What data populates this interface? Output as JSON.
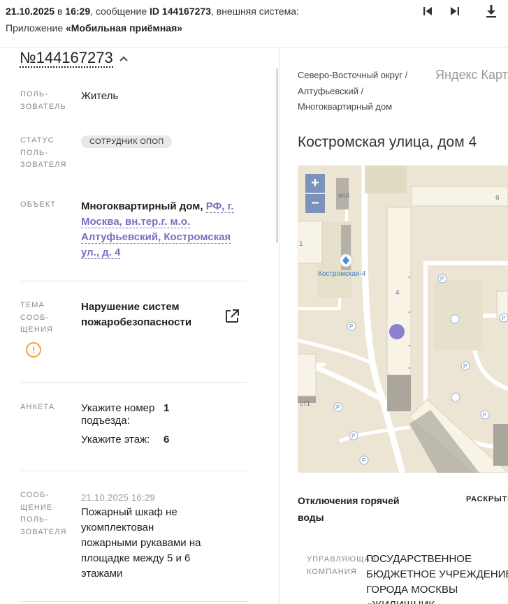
{
  "header": {
    "date": "21.10.2025",
    "in": "в",
    "time": "16:29",
    "message_text": ", сообщение",
    "message_id": "ID 144167273",
    "external_text": ", внешняя система:",
    "app_text": "Приложение",
    "app_name": "«Мобильная приёмная»",
    "icons": [
      "skip-first-icon",
      "skip-next-icon",
      "download-icon"
    ]
  },
  "ticket": {
    "number": "№144167273",
    "icon": "chevron-up-icon"
  },
  "fields": {
    "user": {
      "label": "ПОЛЬ-\nЗОВАТЕЛЬ",
      "value": "Житель"
    },
    "user_status": {
      "label": "СТАТУС\nПОЛЬ-\nЗОВАТЕЛЯ",
      "value": "СОТРУДНИК ОПОП"
    },
    "object": {
      "label": "ОБЪЕКТ",
      "type": "Многоквартирный дом,",
      "address_link": "РФ, г. Москва, вн.тер.г. м.о. Алтуфьевский, Костромская ул., д. 4"
    },
    "topic": {
      "label": "ТЕМА\nСООБ-\nЩЕНИЯ",
      "value": "Нарушение систем пожаробезопасности",
      "icons": [
        "warning-icon",
        "external-link-icon"
      ]
    },
    "anketa": {
      "label": "АНКЕТА",
      "rows": [
        {
          "question": "Укажите номер подъезда:",
          "answer": "1"
        },
        {
          "question": "Укажите этаж:",
          "answer": "6"
        }
      ]
    },
    "message": {
      "label": "СООБ-\nЩЕНИЕ\nПОЛЬ-\nЗОВАТЕЛЯ",
      "date": "21.10.2025 16:29",
      "text": "Пожарный шкаф не укомплектован пожарными рукавами на площадке между 5 и 6 этажами"
    }
  },
  "right": {
    "breadcrumb": "Северо-Восточный округ / Алтуфьевский / Многоквартирный дом",
    "map_provider": "Яндекс Карт",
    "address": "Костромская улица, дом 4",
    "map": {
      "zoom_in": "+",
      "zoom_out": "−",
      "labels": {
        "building_4": "4",
        "building_6": "6",
        "stop": "Костромская-4",
        "vl4": "вл4",
        "st1": "ст1",
        "one": "1",
        "parking": "P"
      }
    },
    "hot_water": {
      "title": "Отключения горячей воды",
      "expand": "РАСКРЫТЬ"
    },
    "management": {
      "label": "УПРАВЛЯЮЩАЯ КОМПАНИЯ",
      "value": "ГОСУДАРСТВЕННОЕ БЮДЖЕТНОЕ УЧРЕЖДЕНИЕ ГОРОДА МОСКВЫ «ЖИЛИЩНИК"
    }
  },
  "colors": {
    "accent": "#7a6fbf",
    "warning": "#f0a23a",
    "badge_bg": "#e8e8e8",
    "map_bg": "#ece5d3",
    "zoom_bg": "#7b93b9",
    "marker": "#8b7fd0"
  }
}
